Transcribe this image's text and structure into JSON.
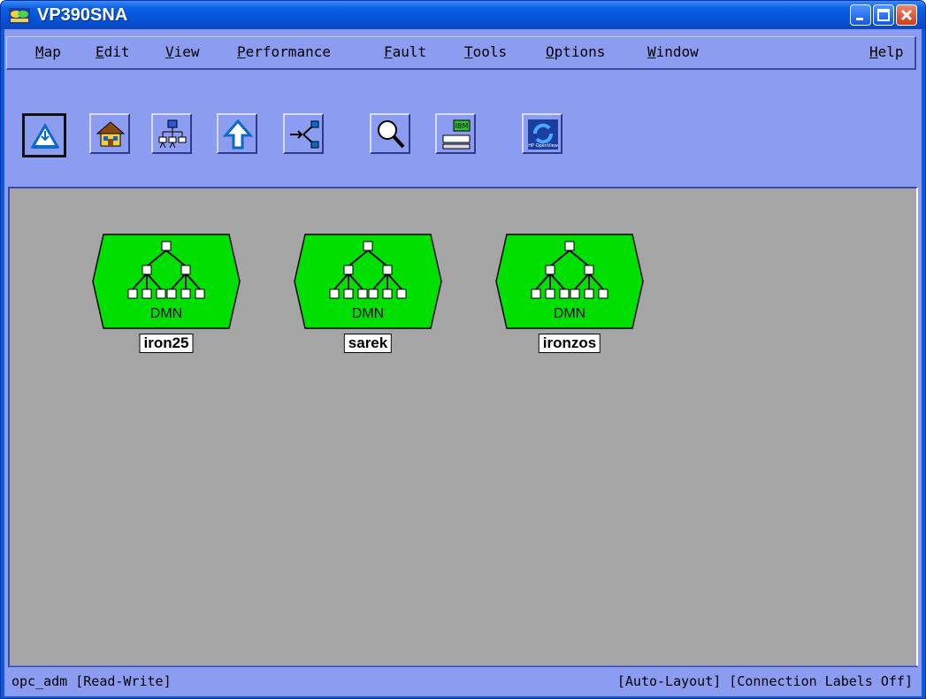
{
  "window": {
    "title": "VP390SNA",
    "app_icon": "ip-logo-icon",
    "controls": [
      {
        "name": "minimize-button",
        "icon": "minimize-icon"
      },
      {
        "name": "maximize-button",
        "icon": "maximize-icon"
      },
      {
        "name": "close-button",
        "icon": "close-icon"
      }
    ]
  },
  "menubar": {
    "items": [
      {
        "label": "Map",
        "mnemonic": "M"
      },
      {
        "label": "Edit",
        "mnemonic": "E"
      },
      {
        "label": "View",
        "mnemonic": "V"
      },
      {
        "label": "Performance",
        "mnemonic": "P"
      },
      {
        "label": "Fault",
        "mnemonic": "F"
      },
      {
        "label": "Tools",
        "mnemonic": "T"
      },
      {
        "label": "Options",
        "mnemonic": "O"
      },
      {
        "label": "Window",
        "mnemonic": "W"
      },
      {
        "label": "Help",
        "mnemonic": "H"
      }
    ]
  },
  "toolbar": {
    "tools": [
      {
        "icon": "open-map-icon",
        "selected": true
      },
      {
        "icon": "home-icon",
        "selected": false
      },
      {
        "icon": "hierarchy-icon",
        "selected": false
      },
      {
        "icon": "up-arrow-icon",
        "selected": false
      },
      {
        "icon": "connections-icon",
        "selected": false
      },
      {
        "icon": "magnifier-icon",
        "selected": false
      },
      {
        "icon": "device-panel-icon",
        "selected": false
      },
      {
        "icon": "hp-openview-icon",
        "selected": false
      }
    ],
    "openview_logo_text": "HP OpenView",
    "device_panel_text": "IBM"
  },
  "map": {
    "background": "#a5a5a5",
    "symbol_fill": "#00e000",
    "nodes": [
      {
        "label": "iron25",
        "type": "DMN"
      },
      {
        "label": "sarek",
        "type": "DMN"
      },
      {
        "label": "ironzos",
        "type": "DMN"
      }
    ]
  },
  "status": {
    "left": "opc_adm [Read-Write]",
    "right": "[Auto-Layout] [Connection Labels Off]"
  },
  "colors": {
    "titlebar": "#0553d8",
    "chrome": "#8c9cf0",
    "close": "#cf3c1c"
  }
}
